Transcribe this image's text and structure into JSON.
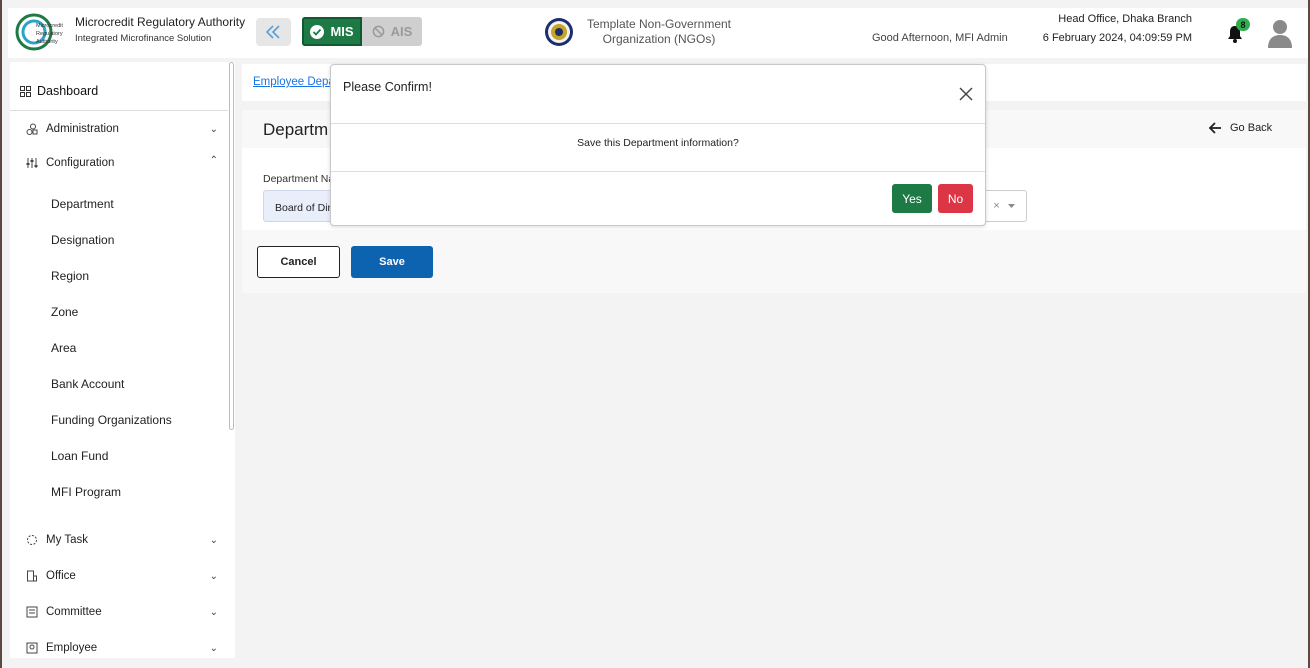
{
  "header": {
    "org_title": "Microcredit Regulatory Authority",
    "org_subtitle": "Integrated Microfinance Solution",
    "logo_text": [
      "Microcredit",
      "Regulatory",
      "Authority"
    ],
    "mode_mis": "MIS",
    "mode_ais": "AIS",
    "ngo_name": "Template Non-Government Organization (NGOs)",
    "greeting": "Good Afternoon, MFI Admin",
    "branch": "Head Office, Dhaka Branch",
    "datetime": "6 February 2024, 04:09:59 PM",
    "notification_count": "8"
  },
  "sidebar": {
    "dashboard": "Dashboard",
    "administration": "Administration",
    "configuration": "Configuration",
    "config_items": [
      "Department",
      "Designation",
      "Region",
      "Zone",
      "Area",
      "Bank Account",
      "Funding Organizations",
      "Loan Fund",
      "MFI Program"
    ],
    "my_task": "My Task",
    "office": "Office",
    "committee": "Committee",
    "employee": "Employee"
  },
  "content": {
    "breadcrumb": "Employee Depa",
    "page_title": "Departm",
    "go_back": "Go Back",
    "field_label": "Department Na",
    "field_value": "Board of Dir",
    "select_clear": "×",
    "cancel": "Cancel",
    "save": "Save"
  },
  "modal": {
    "title": "Please Confirm!",
    "message": "Save this Department information?",
    "yes": "Yes",
    "no": "No"
  },
  "colors": {
    "mis_green": "#1d7a45",
    "save_blue": "#0d63b0",
    "no_red": "#dc3545",
    "link_blue": "#1a73e8"
  }
}
